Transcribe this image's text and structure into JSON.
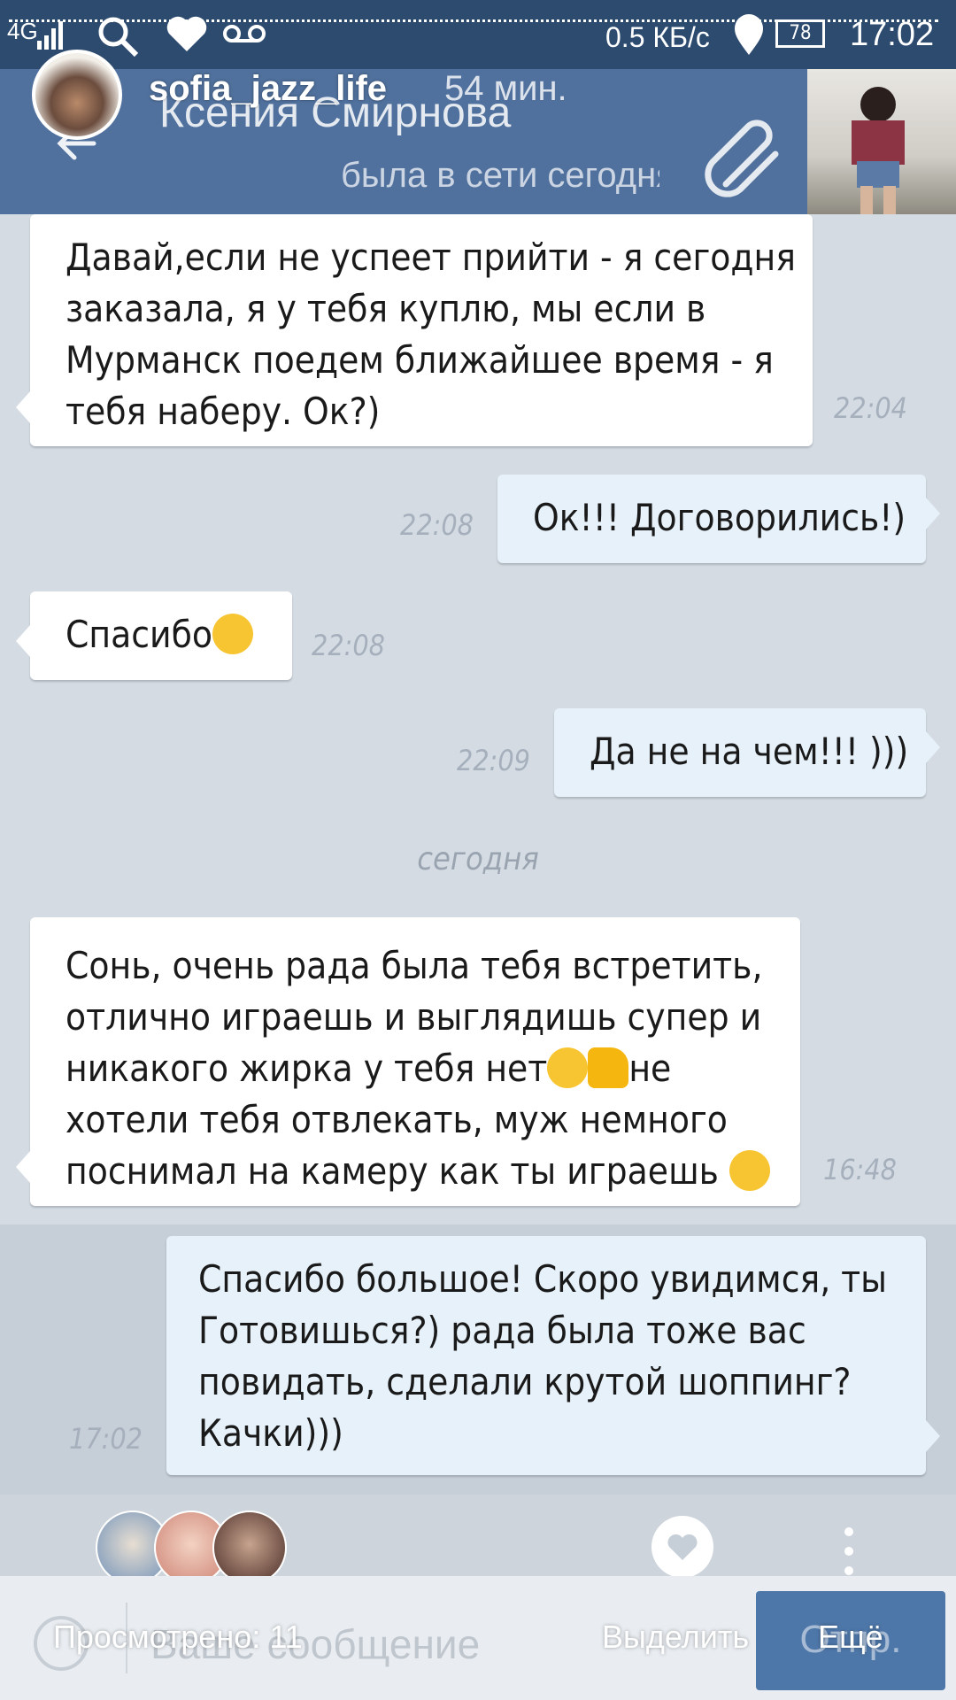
{
  "status_bar": {
    "network": "4G",
    "speed": "0.5 КБ/с",
    "battery": "78",
    "clock": "17:02"
  },
  "header": {
    "contact_name": "Ксения Смирнова",
    "contact_status": "была в сети сегодня"
  },
  "story": {
    "username": "sofia_jazz_life",
    "time_ago": "54 мин."
  },
  "messages": [
    {
      "direction": "in",
      "text": "Давай,если не успеет прийти - я сегодня\nзаказала, я у тебя куплю, мы если в\nМурманск поедем ближайшее время - я\nтебя наберу. Ок?)",
      "time": "22:04"
    },
    {
      "direction": "out",
      "text": "Ок!!! Договорились!)",
      "time": "22:08"
    },
    {
      "direction": "in",
      "text": "Спасибо",
      "time": "22:08"
    },
    {
      "direction": "out",
      "text": "Да не на чем!!! )))",
      "time": "22:09"
    },
    {
      "direction": "in",
      "text_lines": [
        "Сонь, очень рада была тебя встретить,",
        "отлично играешь и выглядишь супер и",
        "никакого жирка у тебя нет",
        "не",
        "хотели тебя отвлекать, муж немного",
        "поснимал на камеру как ты играешь"
      ],
      "time": "16:48"
    },
    {
      "direction": "out",
      "text": "Спасибо большое! Скоро увидимся, ты\nГотовишься?) рада была тоже вас\nповидать, сделали крутой шоппинг?\nКачки)))",
      "time": "17:02"
    }
  ],
  "day_separator": "сегодня",
  "input": {
    "placeholder": "Ваше сообщение",
    "send_label": "Отпр."
  },
  "story_footer": {
    "viewed": "Просмотрено: 11",
    "highlight": "Выделить",
    "more": "Ещё"
  }
}
